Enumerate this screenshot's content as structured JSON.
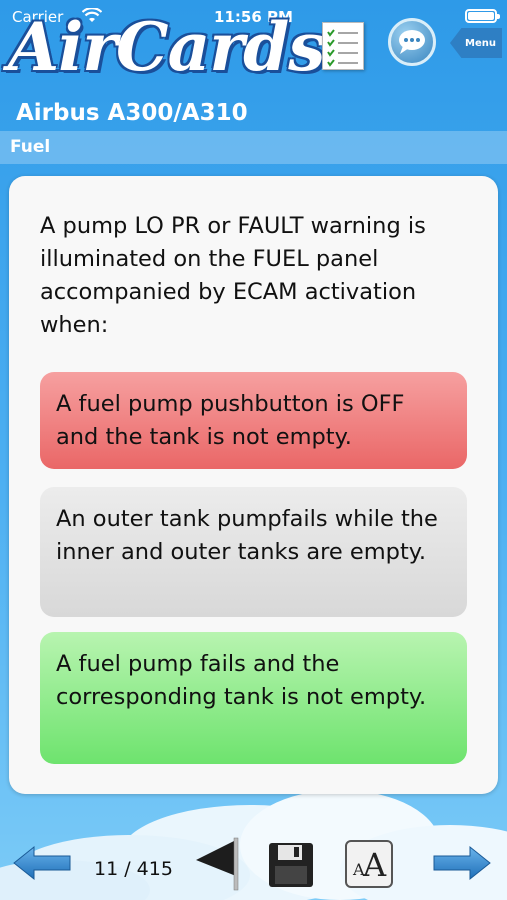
{
  "status_bar": {
    "carrier": "Carrier",
    "time": "11:56 PM"
  },
  "header": {
    "logo_text": "AirCards",
    "aircraft": "Airbus A300/A310",
    "section": "Fuel",
    "menu_label": "Menu"
  },
  "card": {
    "question": "A pump LO PR or FAULT warning is illuminated on the FUEL panel accompanied by ECAM activation when:",
    "answers": [
      {
        "text": "A fuel pump pushbutton is OFF and the tank is not empty.",
        "state": "incorrect",
        "color": "#ef7a7a"
      },
      {
        "text": "An outer tank pumpfails while the inner and outer tanks are empty.",
        "state": "neutral",
        "color": "#e2e2e2"
      },
      {
        "text": "A fuel pump fails and the corresponding tank is not empty.",
        "state": "correct",
        "color": "#8ff08a"
      }
    ]
  },
  "footer": {
    "counter": "11 / 415",
    "icons": [
      "arrow-left-icon",
      "flag-icon",
      "save-icon",
      "font-size-icon",
      "arrow-right-icon"
    ]
  }
}
